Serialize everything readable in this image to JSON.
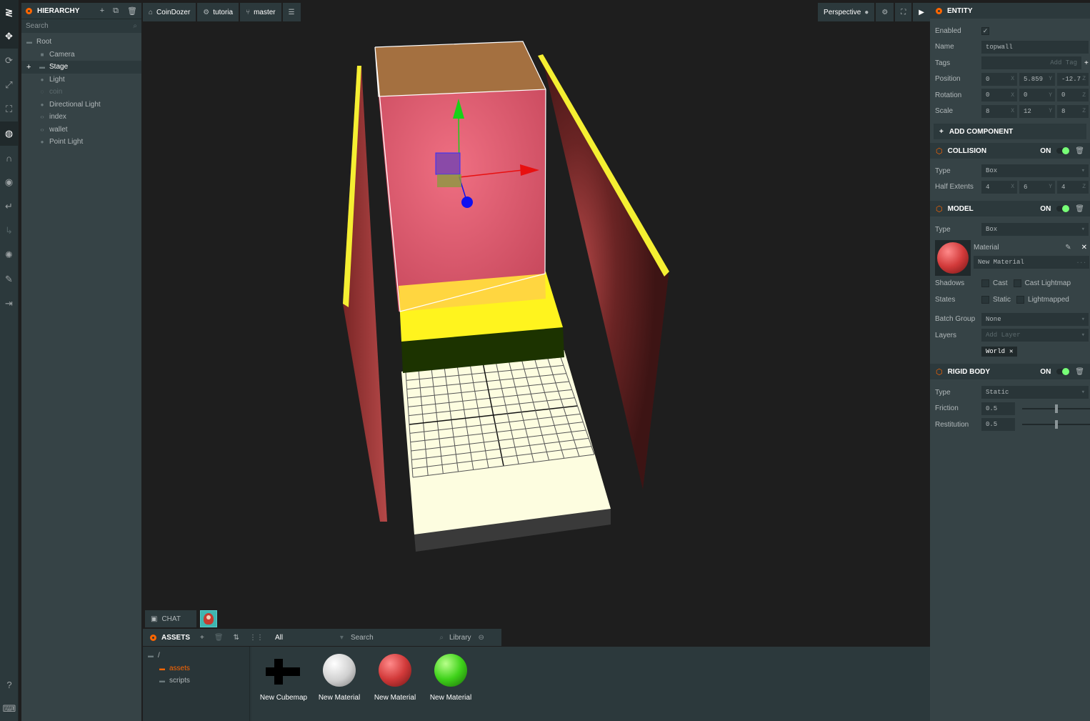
{
  "hierarchy": {
    "title": "HIERARCHY",
    "search_placeholder": "Search",
    "nodes": [
      {
        "label": "Root"
      },
      {
        "label": "Camera"
      },
      {
        "label": "Stage"
      },
      {
        "label": "Light"
      },
      {
        "label": "coin"
      },
      {
        "label": "Directional Light"
      },
      {
        "label": "index"
      },
      {
        "label": "wallet"
      },
      {
        "label": "Point Light"
      }
    ]
  },
  "topbar": {
    "project": "CoinDozer",
    "scene": "tutoria",
    "branch": "master",
    "camera": "Perspective"
  },
  "chat": {
    "label": "CHAT"
  },
  "assets": {
    "title": "ASSETS",
    "filter": "All",
    "search_placeholder": "Search",
    "library": "Library",
    "folders": [
      "/",
      "assets",
      "scripts"
    ],
    "items": [
      {
        "label": "New Cubemap",
        "icon": "cubemap-cross-icon"
      },
      {
        "label": "New Material",
        "color": "#e8e8e8"
      },
      {
        "label": "New Material",
        "color": "#d23a3a"
      },
      {
        "label": "New Material",
        "color": "#3fd21a"
      }
    ]
  },
  "inspector": {
    "entity": {
      "title": "ENTITY",
      "enabled_label": "Enabled",
      "name_label": "Name",
      "name_value": "topwall",
      "tags_label": "Tags",
      "tags_placeholder": "Add Tag",
      "position_label": "Position",
      "position": [
        "0",
        "5.859",
        "-12.7"
      ],
      "rotation_label": "Rotation",
      "rotation": [
        "0",
        "0",
        "0"
      ],
      "scale_label": "Scale",
      "scale": [
        "8",
        "12",
        "8"
      ],
      "add_component": "ADD COMPONENT"
    },
    "collision": {
      "title": "COLLISION",
      "state": "ON",
      "type_label": "Type",
      "type_value": "Box",
      "half_label": "Half Extents",
      "half": [
        "4",
        "6",
        "4"
      ]
    },
    "model": {
      "title": "MODEL",
      "state": "ON",
      "type_label": "Type",
      "type_value": "Box",
      "material_label": "Material",
      "material_value": "New Material",
      "shadows_label": "Shadows",
      "cast": "Cast",
      "cast_lightmap": "Cast Lightmap",
      "states_label": "States",
      "static": "Static",
      "lightmapped": "Lightmapped",
      "batch_label": "Batch Group",
      "batch_value": "None",
      "layers_label": "Layers",
      "layers_placeholder": "Add Layer",
      "layer_chip": "World"
    },
    "rigidbody": {
      "title": "RIGID BODY",
      "state": "ON",
      "type_label": "Type",
      "type_value": "Static",
      "friction_label": "Friction",
      "friction_value": "0.5",
      "restitution_label": "Restitution",
      "restitution_value": "0.5"
    }
  },
  "colors": {
    "panel": "#364346",
    "header": "#2c393c",
    "accent": "#ff6600"
  }
}
